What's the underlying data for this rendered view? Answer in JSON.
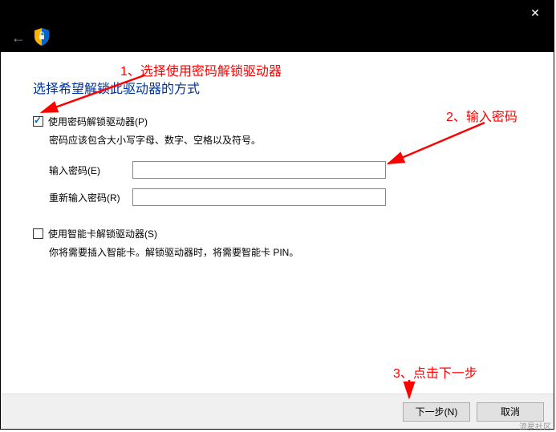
{
  "titlebar": {
    "close_glyph": "✕"
  },
  "navbar": {
    "back_glyph": "←"
  },
  "heading": "选择希望解锁此驱动器的方式",
  "option_password": {
    "label": "使用密码解锁驱动器(P)",
    "checked": true,
    "desc": "密码应该包含大小写字母、数字、空格以及符号。",
    "enter_label": "输入密码(E)",
    "reenter_label": "重新输入密码(R)",
    "value1": "",
    "value2": ""
  },
  "option_smartcard": {
    "label": "使用智能卡解锁驱动器(S)",
    "checked": false,
    "desc": "你将需要插入智能卡。解锁驱动器时，将需要智能卡 PIN。"
  },
  "footer": {
    "next": "下一步(N)",
    "cancel": "取消"
  },
  "annotations": {
    "a1": "1、选择使用密码解锁驱动器",
    "a2": "2、输入密码",
    "a3": "3、点击下一步"
  },
  "watermark": "流星社区"
}
